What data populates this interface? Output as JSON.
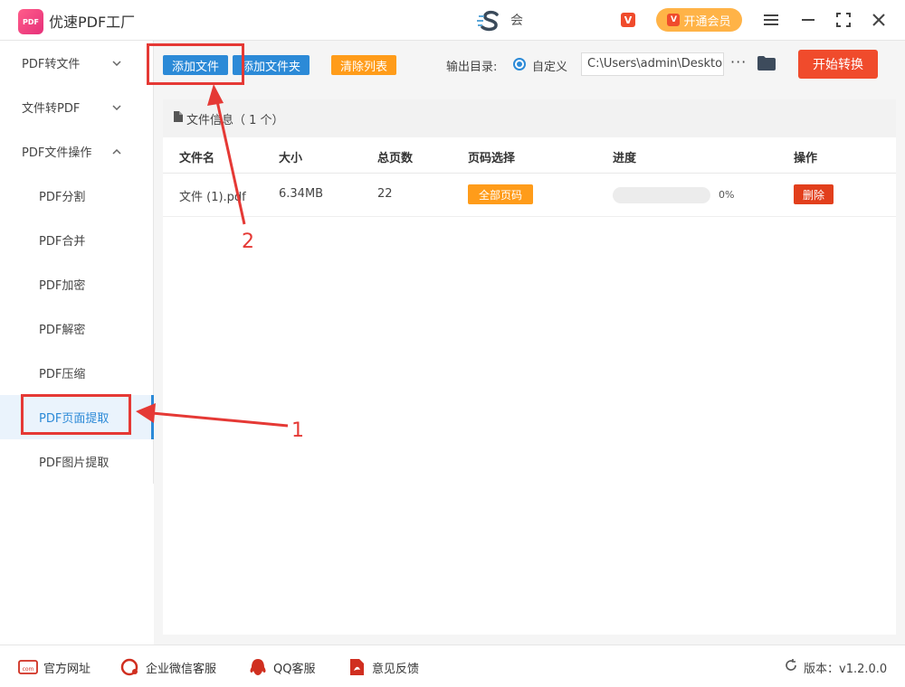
{
  "app": {
    "title": "优速PDF工厂",
    "logo_text": "PDF",
    "center_text": "会",
    "vip_label": "开通会员",
    "vip_icon_text": "V"
  },
  "window_controls": [
    "menu-icon",
    "minimize-icon",
    "maximize-icon",
    "close-icon"
  ],
  "sidebar": {
    "items": [
      {
        "label": "PDF转文件",
        "chevron": "⌄"
      },
      {
        "label": "文件转PDF",
        "chevron": "⌄"
      },
      {
        "label": "PDF文件操作",
        "chevron": "⌃"
      },
      {
        "label": "PDF分割"
      },
      {
        "label": "PDF合并"
      },
      {
        "label": "PDF加密"
      },
      {
        "label": "PDF解密"
      },
      {
        "label": "PDF压缩"
      },
      {
        "label": "PDF页面提取"
      },
      {
        "label": "PDF图片提取"
      }
    ]
  },
  "toolbar": {
    "add_file": "添加文件",
    "add_folder": "添加文件夹",
    "clear_list": "清除列表",
    "output_label": "输出目录:",
    "radio_label": "自定义",
    "output_path": "C:\\Users\\admin\\Deskto",
    "more": "···",
    "start": "开始转换"
  },
  "file_info": {
    "label": "文件信息（ 1 个）"
  },
  "table": {
    "headers": [
      "文件名",
      "大小",
      "总页数",
      "页码选择",
      "进度",
      "操作"
    ],
    "rows": [
      {
        "name": "文件 (1).pdf",
        "size": "6.34MB",
        "pages": "22",
        "page_select": "全部页码",
        "progress_text": "0%",
        "progress_fraction": 0,
        "action": "删除"
      }
    ]
  },
  "footer": {
    "website": "官方网址",
    "wechat": "企业微信客服",
    "qq": "QQ客服",
    "feedback": "意见反馈",
    "version": "版本：v1.2.0.0"
  },
  "annotations": {
    "label_1": "1",
    "label_2": "2"
  },
  "colors": {
    "primary": "#2c8ad7",
    "accent_red": "#f04b2c",
    "orange": "#ff9c1a",
    "vip": "#ffb347"
  }
}
